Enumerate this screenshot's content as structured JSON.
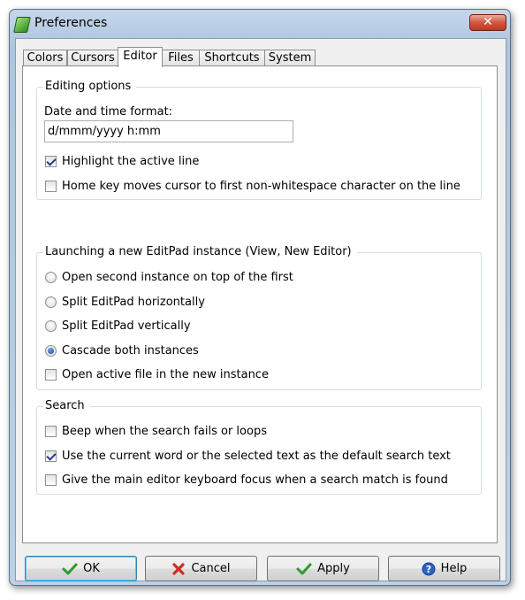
{
  "window": {
    "title": "Preferences",
    "close_label": "✕"
  },
  "tabs": [
    {
      "label": "Colors"
    },
    {
      "label": "Cursors"
    },
    {
      "label": "Editor"
    },
    {
      "label": "Files"
    },
    {
      "label": "Shortcuts"
    },
    {
      "label": "System"
    }
  ],
  "active_tab": "Editor",
  "editing": {
    "title": "Editing options",
    "date_label": "Date and time format:",
    "date_value": "d/mmm/yyyy h:mm",
    "highlight_label": "Highlight the active line",
    "highlight_checked": true,
    "homekey_label": "Home key moves cursor to first non-whitespace character on the line",
    "homekey_checked": false
  },
  "launching": {
    "title": "Launching a new EditPad instance (View, New Editor)",
    "options": [
      {
        "label": "Open second instance on top of the first",
        "selected": false
      },
      {
        "label": "Split EditPad horizontally",
        "selected": false
      },
      {
        "label": "Split EditPad vertically",
        "selected": false
      },
      {
        "label": "Cascade both instances",
        "selected": true
      }
    ],
    "open_active_label": "Open active file in the new instance",
    "open_active_checked": false
  },
  "search": {
    "title": "Search",
    "beep_label": "Beep when the search fails or loops",
    "beep_checked": false,
    "current_word_label": "Use the current word or the selected text as the default search text",
    "current_word_checked": true,
    "focus_label": "Give the main editor keyboard focus when a search match is found",
    "focus_checked": false
  },
  "buttons": {
    "ok": "OK",
    "cancel": "Cancel",
    "apply": "Apply",
    "help": "Help"
  },
  "icons": {
    "app": "editpad-app-icon",
    "close": "close-icon",
    "ok": "checkmark-icon",
    "cancel": "red-x-icon",
    "apply": "checkmark-icon",
    "help": "help-question-icon"
  },
  "colors": {
    "ok_check": "#2f9a2f",
    "cancel_x": "#d42b1e",
    "help_circle": "#2b62c4"
  }
}
